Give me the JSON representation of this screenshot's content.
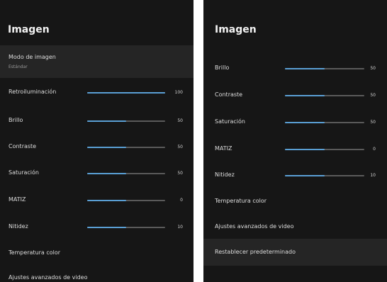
{
  "left_panel": {
    "title": "Imagen",
    "picture_mode": {
      "label": "Modo de imagen",
      "value": "Estándar"
    },
    "sliders": [
      {
        "label": "Retroiluminación",
        "value": 100,
        "display": "100"
      },
      {
        "label": "Brillo",
        "value": 50,
        "display": "50"
      },
      {
        "label": "Contraste",
        "value": 50,
        "display": "50"
      },
      {
        "label": "Saturación",
        "value": 50,
        "display": "50"
      },
      {
        "label": "MATIZ",
        "value": 50,
        "display": "0"
      },
      {
        "label": "Nitidez",
        "value": 50,
        "display": "10"
      }
    ],
    "items": [
      {
        "label": "Temperatura color"
      },
      {
        "label": "Ajustes avanzados de video"
      }
    ]
  },
  "right_panel": {
    "title": "Imagen",
    "sliders": [
      {
        "label": "Brillo",
        "value": 50,
        "display": "50"
      },
      {
        "label": "Contraste",
        "value": 50,
        "display": "50"
      },
      {
        "label": "Saturación",
        "value": 50,
        "display": "50"
      },
      {
        "label": "MATIZ",
        "value": 50,
        "display": "0"
      },
      {
        "label": "Nitidez",
        "value": 50,
        "display": "10"
      }
    ],
    "items": [
      {
        "label": "Temperatura color"
      },
      {
        "label": "Ajustes avanzados de video"
      },
      {
        "label": "Restablecer predeterminado"
      }
    ]
  },
  "colors": {
    "panel_background": "#161616",
    "selected_row": "#252525",
    "slider_fill": "#5a9fd4",
    "slider_track": "#5a5a5a"
  }
}
